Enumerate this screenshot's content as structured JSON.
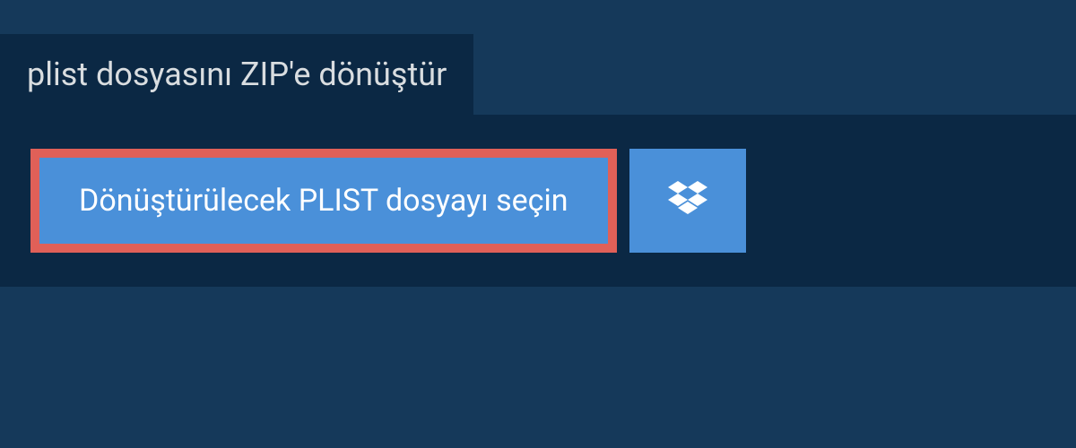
{
  "header": {
    "title": "plist dosyasını ZIP'e dönüştür"
  },
  "actions": {
    "select_file_label": "Dönüştürülecek PLIST dosyayı seçin",
    "dropbox_icon": "dropbox-icon"
  }
}
